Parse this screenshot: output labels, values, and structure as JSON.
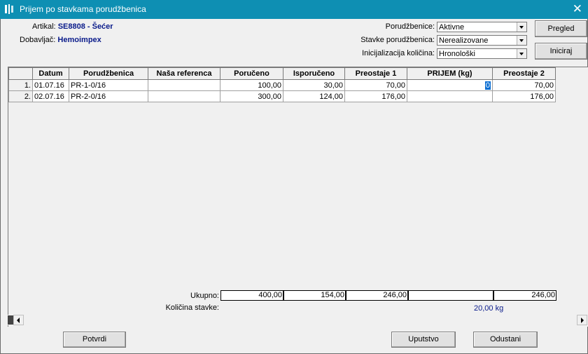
{
  "window": {
    "title": "Prijem po stavkama porudžbenica",
    "close_glyph": "✕"
  },
  "article": {
    "label": "Artikal:",
    "value": "SE8808 - Šećer"
  },
  "supplier": {
    "label": "Dobavljač:",
    "value": "Hemoimpex"
  },
  "filters": [
    {
      "label": "Porudžbenice:",
      "value": "Aktivne"
    },
    {
      "label": "Stavke porudžbenica:",
      "value": "Nerealizovane"
    },
    {
      "label": "Inicijalizacija količina:",
      "value": "Hronološki"
    }
  ],
  "buttons": {
    "pregled": "Pregled",
    "iniciraj": "Iniciraj",
    "potvrdi": "Potvrdi",
    "uputstvo": "Uputstvo",
    "odustani": "Odustani"
  },
  "table": {
    "columns": [
      "Datum",
      "Porudžbenica",
      "Naša referenca",
      "Poručeno",
      "Isporučeno",
      "Preostaje 1",
      "PRIJEM (kg)",
      "Preostaje 2"
    ],
    "rows": [
      {
        "num": "1.",
        "datum": "01.07.16",
        "porudzbenica": "PR-1-0/16",
        "referenca": "",
        "poruceno": "100,00",
        "isporuceno": "30,00",
        "preostaje1": "70,00",
        "prijem": "0",
        "preostaje2": "70,00"
      },
      {
        "num": "2.",
        "datum": "02.07.16",
        "porudzbenica": "PR-2-0/16",
        "referenca": "",
        "poruceno": "300,00",
        "isporuceno": "124,00",
        "preostaje1": "176,00",
        "prijem": "",
        "preostaje2": "176,00"
      }
    ]
  },
  "totals": {
    "label": "Ukupno:",
    "poruceno": "400,00",
    "isporuceno": "154,00",
    "preostaje1": "246,00",
    "prijem": "",
    "preostaje2": "246,00"
  },
  "kolicina": {
    "label": "Količina stavke:",
    "value": "20,00 kg"
  }
}
